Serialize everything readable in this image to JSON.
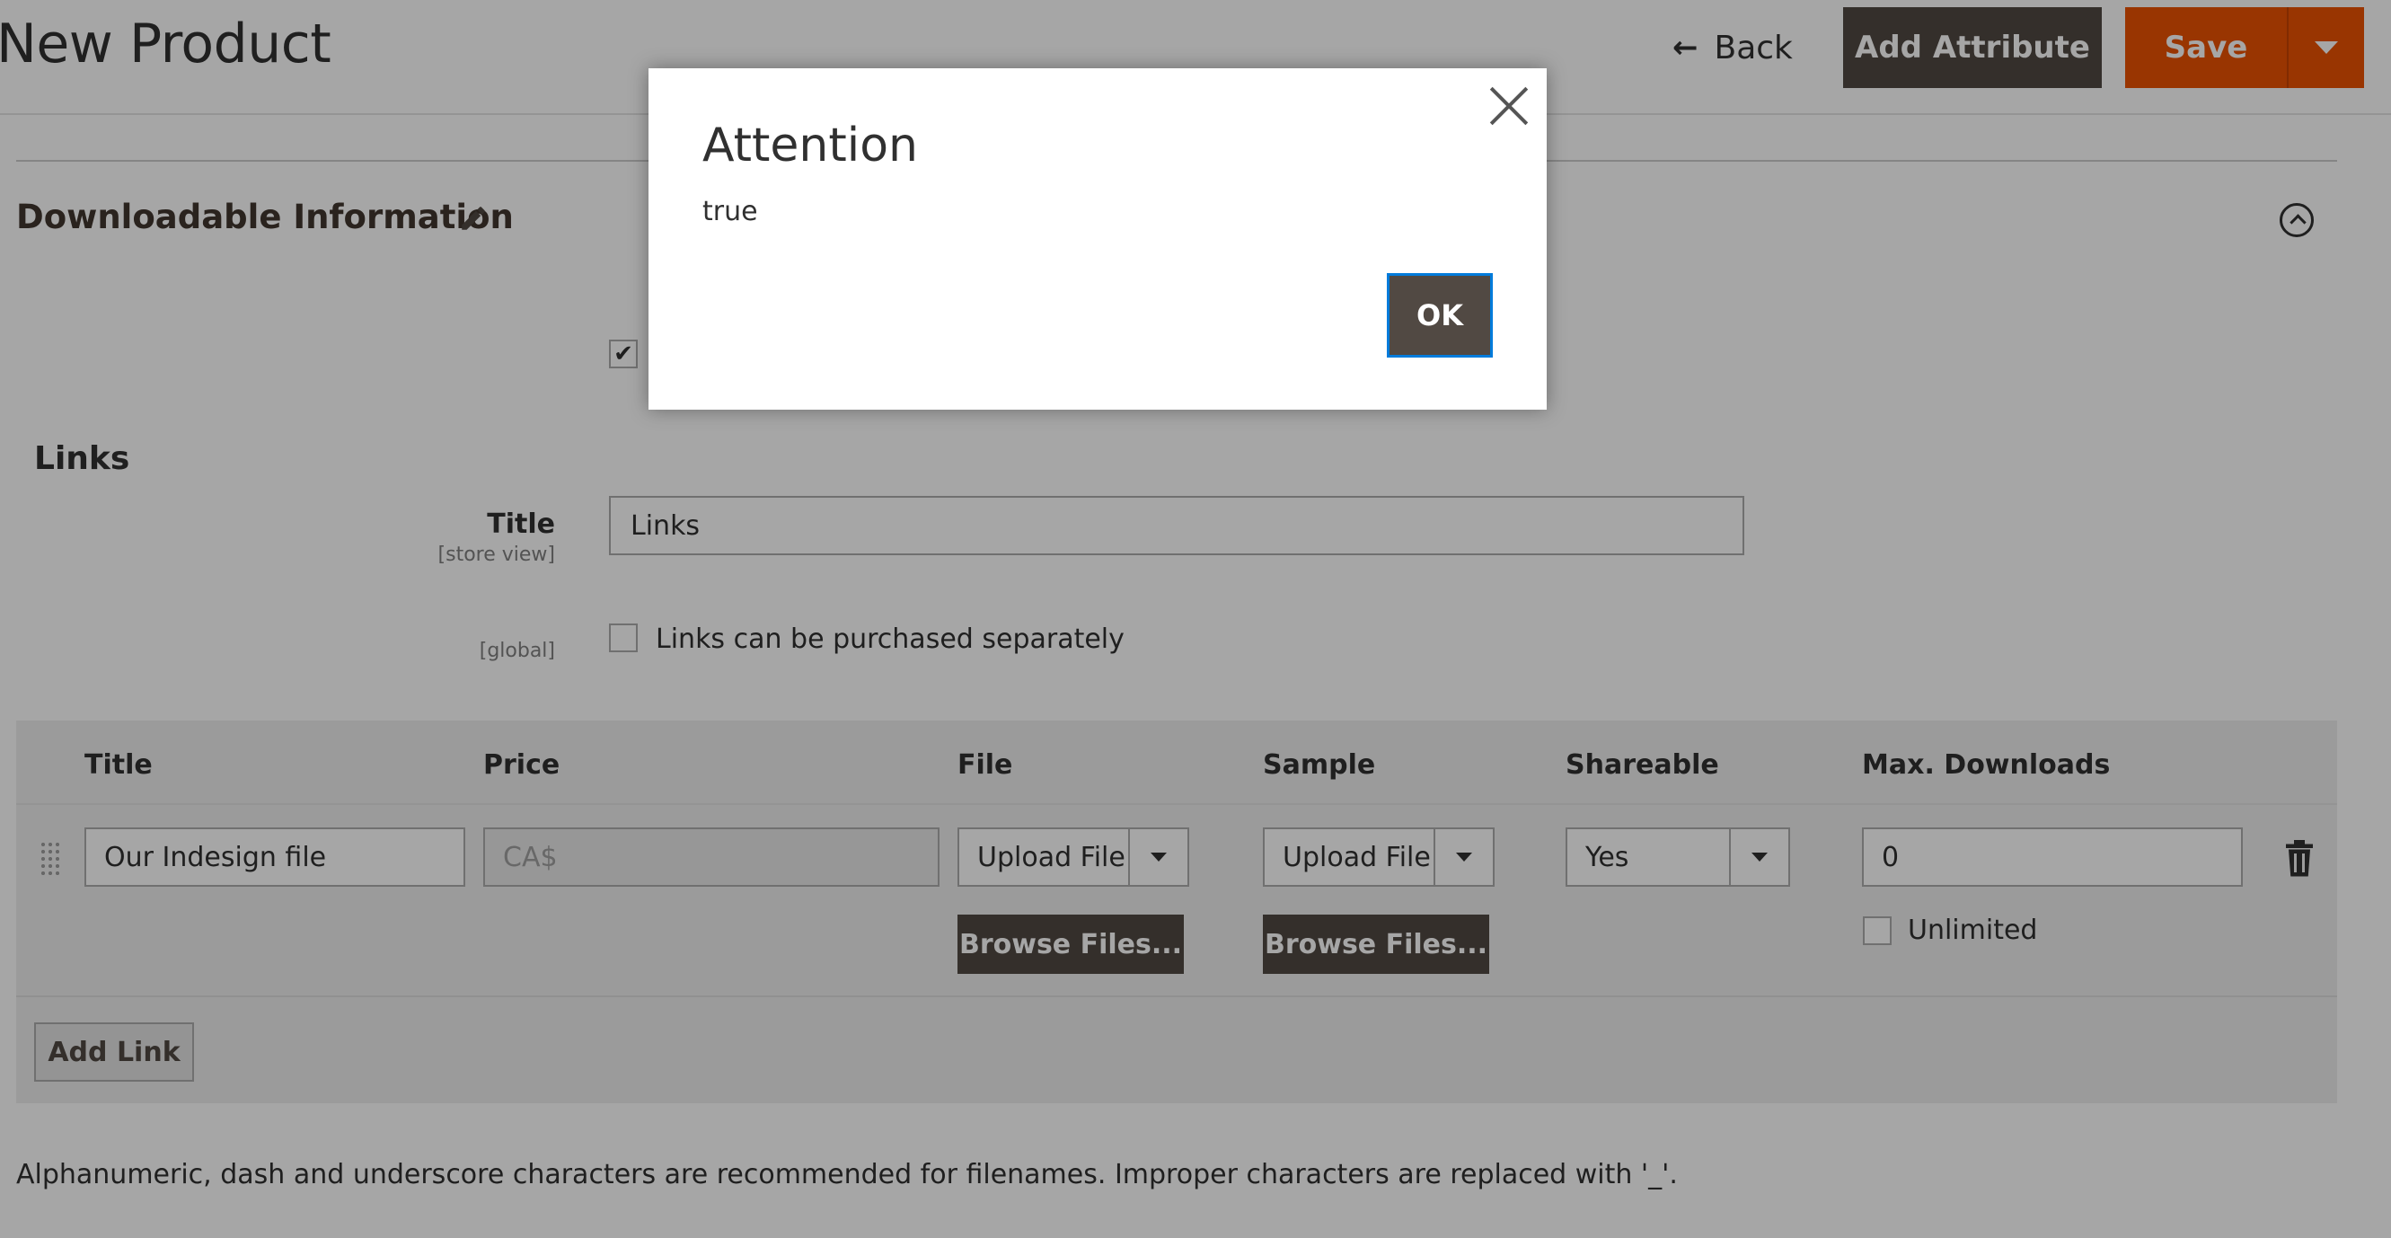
{
  "header": {
    "page_title": "New Product",
    "back_label": "Back",
    "add_attribute_label": "Add Attribute",
    "save_label": "Save"
  },
  "section": {
    "title": "Downloadable Information",
    "is_downloadable_checked": true
  },
  "links": {
    "heading": "Links",
    "title_label": "Title",
    "title_scope": "[store view]",
    "title_value": "Links",
    "global_scope": "[global]",
    "separate_label": "Links can be purchased separately",
    "separate_checked": false,
    "table": {
      "columns": [
        "Title",
        "Price",
        "File",
        "Sample",
        "Shareable",
        "Max. Downloads"
      ],
      "rows": [
        {
          "title": "Our Indesign file",
          "price_placeholder": "CA$",
          "file_type": "Upload File",
          "file_browse": "Browse Files...",
          "sample_type": "Upload File",
          "sample_browse": "Browse Files...",
          "shareable": "Yes",
          "max_downloads": "0",
          "unlimited_label": "Unlimited",
          "unlimited_checked": false
        }
      ]
    },
    "add_link_label": "Add Link"
  },
  "note": "Alphanumeric, dash and underscore characters are recommended for filenames. Improper characters are replaced with '_'.",
  "modal": {
    "title": "Attention",
    "body": "true",
    "ok_label": "OK"
  },
  "colors": {
    "primary_dark": "#514943",
    "accent_orange": "#eb5202",
    "focus_blue": "#007bdb"
  }
}
